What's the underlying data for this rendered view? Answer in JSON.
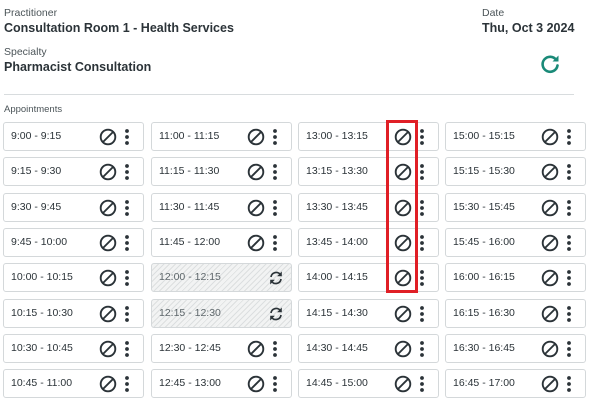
{
  "header": {
    "practitioner_label": "Practitioner",
    "practitioner_value": "Consultation Room 1 - Health Services",
    "specialty_label": "Specialty",
    "specialty_value": "Pharmacist Consultation",
    "date_label": "Date",
    "date_value": "Thu, Oct 3 2024"
  },
  "appointments_label": "Appointments",
  "colors": {
    "accent": "#1a8a78",
    "highlight": "#e01f26",
    "text": "#2b3338"
  },
  "columns": [
    {
      "slots": [
        {
          "time": "9:00 - 9:15",
          "status": "open"
        },
        {
          "time": "9:15 - 9:30",
          "status": "open"
        },
        {
          "time": "9:30 - 9:45",
          "status": "open"
        },
        {
          "time": "9:45 - 10:00",
          "status": "open"
        },
        {
          "time": "10:00 - 10:15",
          "status": "open"
        },
        {
          "time": "10:15 - 10:30",
          "status": "open"
        },
        {
          "time": "10:30 - 10:45",
          "status": "open"
        },
        {
          "time": "10:45 - 11:00",
          "status": "open"
        }
      ]
    },
    {
      "slots": [
        {
          "time": "11:00 - 11:15",
          "status": "open"
        },
        {
          "time": "11:15 - 11:30",
          "status": "open"
        },
        {
          "time": "11:30 - 11:45",
          "status": "open"
        },
        {
          "time": "11:45 - 12:00",
          "status": "open"
        },
        {
          "time": "12:00 - 12:15",
          "status": "booked"
        },
        {
          "time": "12:15 - 12:30",
          "status": "booked"
        },
        {
          "time": "12:30 - 12:45",
          "status": "open"
        },
        {
          "time": "12:45 - 13:00",
          "status": "open"
        }
      ]
    },
    {
      "slots": [
        {
          "time": "13:00 - 13:15",
          "status": "open"
        },
        {
          "time": "13:15 - 13:30",
          "status": "open"
        },
        {
          "time": "13:30 - 13:45",
          "status": "open"
        },
        {
          "time": "13:45 - 14:00",
          "status": "open"
        },
        {
          "time": "14:00 - 14:15",
          "status": "open"
        },
        {
          "time": "14:15 - 14:30",
          "status": "open"
        },
        {
          "time": "14:30 - 14:45",
          "status": "open"
        },
        {
          "time": "14:45 - 15:00",
          "status": "open"
        }
      ]
    },
    {
      "slots": [
        {
          "time": "15:00 - 15:15",
          "status": "open"
        },
        {
          "time": "15:15 - 15:30",
          "status": "open"
        },
        {
          "time": "15:30 - 15:45",
          "status": "open"
        },
        {
          "time": "15:45 - 16:00",
          "status": "open"
        },
        {
          "time": "16:00 - 16:15",
          "status": "open"
        },
        {
          "time": "16:15 - 16:30",
          "status": "open"
        },
        {
          "time": "16:30 - 16:45",
          "status": "open"
        },
        {
          "time": "16:45 - 17:00",
          "status": "open"
        }
      ]
    }
  ]
}
